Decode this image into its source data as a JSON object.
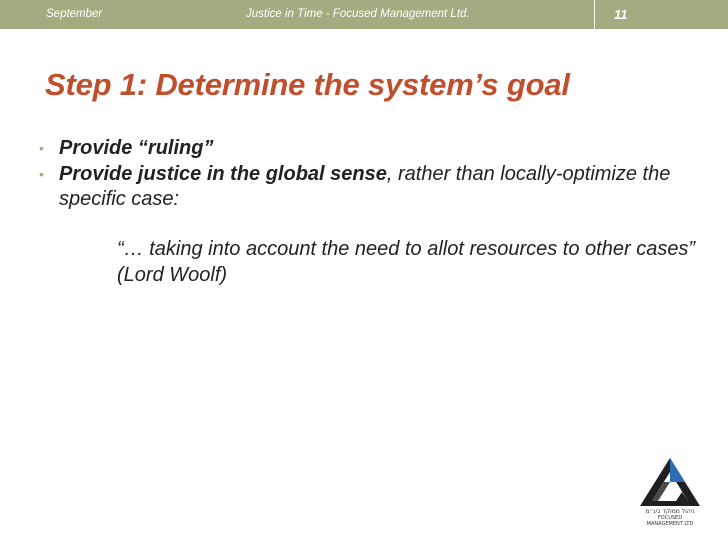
{
  "header": {
    "date": "September",
    "center_text": "Justice in Time - Focused Management Ltd.",
    "page_number": "11"
  },
  "slide": {
    "title": "Step 1: Determine the system’s goal",
    "bullet1": "Provide “ruling”",
    "bullet2_bold": "Provide justice in the global sense",
    "bullet2_rest": ", rather than locally-optimize the specific case:",
    "quote": "“… taking into account the need to allot resources to other cases” (Lord Woolf)"
  },
  "logo": {
    "icon": "triangle-logo-icon",
    "hebrew_text": "ניהול ממוקד בע״מ",
    "english_text": "FOCUSED MANAGEMENT LTD"
  },
  "colors": {
    "header_bar": "#a5ab81",
    "title": "#c0502d",
    "body_text": "#222222"
  }
}
